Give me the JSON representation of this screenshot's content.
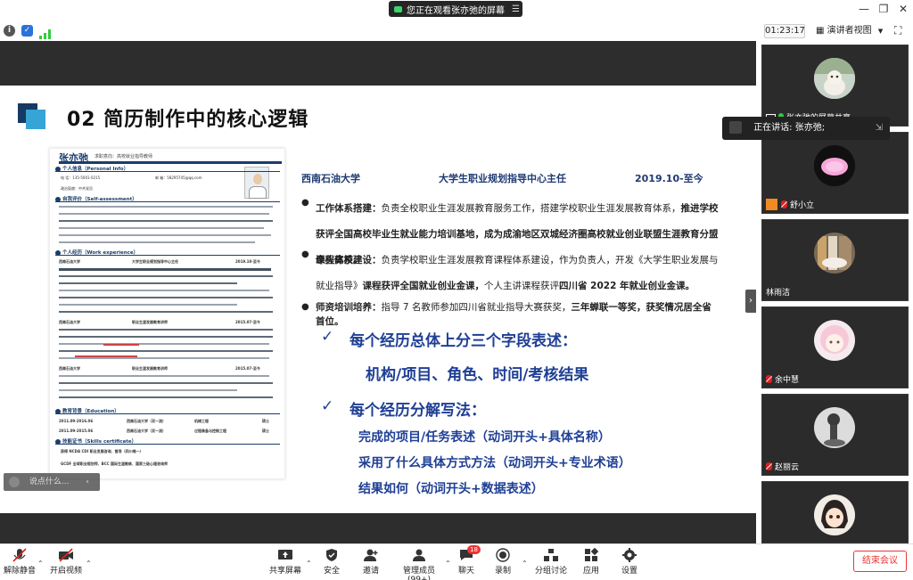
{
  "banner": {
    "text": "您正在观看张亦弛的屏幕"
  },
  "infobar": {
    "timer": "01:23:17",
    "view_mode": "演讲者视图"
  },
  "slide": {
    "title": "02 简历制作中的核心逻辑",
    "resume": {
      "name": "张亦弛",
      "subtitle": "求职意向：高校就业指导教师",
      "sections": [
        "个人信息（Personal Info）",
        "自我评价（Self-assessment）",
        "个人经历（Work experience）",
        "教育背景（Education）",
        "技能证书（Skills certificate）"
      ],
      "info_tel": "电 话：135-5001-0215",
      "info_mail": "邮 箱：58295745@qq.com",
      "info_politics": "政治面貌：中共党员",
      "exp1": {
        "org": "西南石油大学",
        "role": "大学生职业规划指导中心主任",
        "date": "2019.10-至今"
      },
      "exp2": {
        "org": "西南石油大学",
        "role": "职业生涯发展教育讲师",
        "date": "2015.07-至今"
      },
      "exp3": {
        "org": "西南石油大学",
        "role": "职业生涯发展教育讲师",
        "date": "2015.07-至今"
      },
      "edu1": {
        "date": "2011.09-2016.06",
        "school": "西南石油大学（双一流）",
        "major": "机械工程",
        "degree": "硕士"
      },
      "edu2": {
        "date": "2011.09-2015.06",
        "school": "西南石油大学（双一流）",
        "major": "过程装备与控制工程",
        "degree": "硕士"
      },
      "skill1": "获得 NCDA CDI 职业发展咨询、督导（四川唯一）",
      "skill2": "GCDF 全球职业规划师、BCC 国际生涯教练、国家三级心理咨询师"
    },
    "exp_header": {
      "org": "西南石油大学",
      "role": "大学生职业规划指导中心主任",
      "date": "2019.10-至今"
    },
    "bullets": [
      {
        "label": "工作体系搭建：",
        "text": "负责全校职业生涯发展教育服务工作，搭建学校职业生涯发展教育体系，",
        "bold": "推进学校获评全国高校毕业生就业能力培训基地，成为成渝地区双城经济圈高校就业创业联盟生涯教育分盟牵头高校。"
      },
      {
        "label": "课程体系建设：",
        "text": "负责学校职业生涯发展教育课程体系建设，作为负责人，开发《大学生职业发展与就业指导》",
        "bold": "课程获评全国就业创业金课，",
        "text2": "个人主讲课程获评",
        "bold2": "四川省 2022 年就业创业金课。"
      },
      {
        "label": "师资培训培养：",
        "text": "指导 7 名教师参加四川省就业指导大赛获奖，",
        "bold": "三年蝉联一等奖，获奖情况居全省首位。"
      }
    ],
    "check1": "每个经历总体上分三个字段表述：",
    "check1_sub": "机构/项目、角色、时间/考核结果",
    "check2": "每个经历分解写法：",
    "sub_items": [
      "完成的项目/任务表述（动词开头+具体名称）",
      "采用了什么具体方式方法（动词开头+专业术语）",
      "结果如何（动词开头+数据表述）"
    ]
  },
  "chat_input": {
    "placeholder": "说点什么..."
  },
  "gallery": {
    "speaking": "正在讲话: 张亦弛;",
    "participants": [
      {
        "name": "张亦弛的屏幕共享",
        "mic": "on"
      },
      {
        "name": "舒小立",
        "mic": "muted"
      },
      {
        "name": "林雨洁",
        "mic": "none"
      },
      {
        "name": "余中慧",
        "mic": "muted"
      },
      {
        "name": "赵丽云",
        "mic": "muted"
      },
      {
        "name": "",
        "mic": "none"
      }
    ]
  },
  "toolbar": {
    "unmute": "解除静音",
    "video": "开启视频",
    "share": "共享屏幕",
    "security": "安全",
    "invite": "邀请",
    "members": "管理成员(99+)",
    "chat": "聊天",
    "chat_badge": "18",
    "record": "录制",
    "breakout": "分组讨论",
    "apps": "应用",
    "settings": "设置",
    "end": "结束会议"
  }
}
